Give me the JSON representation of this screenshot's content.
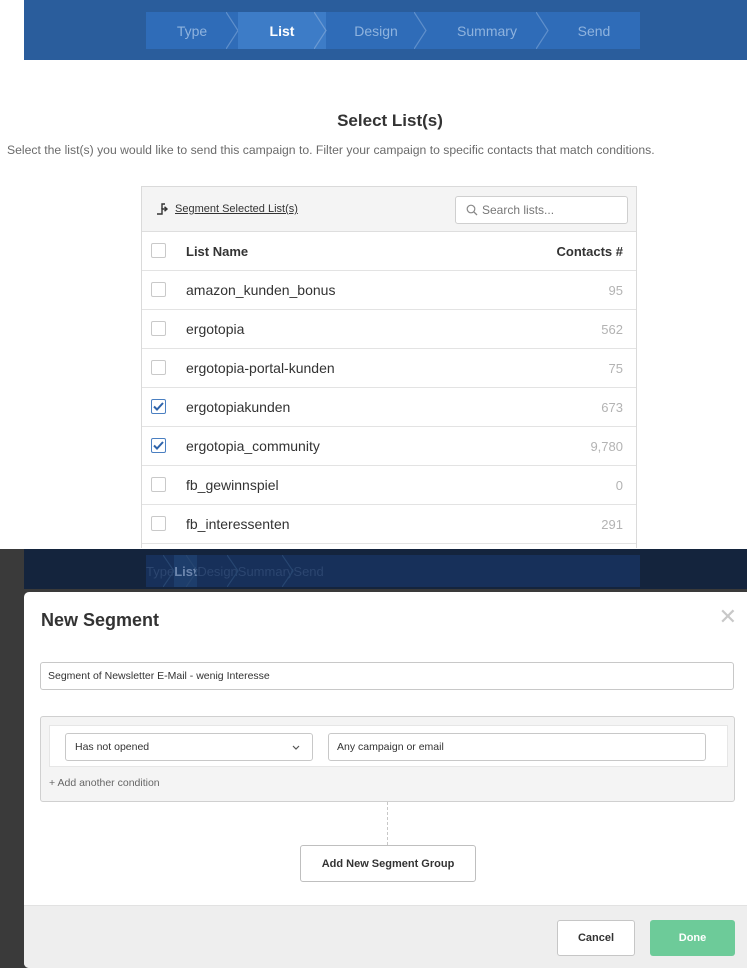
{
  "steps": [
    "Type",
    "List",
    "Design",
    "Summary",
    "Send"
  ],
  "active_step": "List",
  "page": {
    "title": "Select List(s)",
    "subtitle": "Select the list(s) you would like to send this campaign to. Filter your campaign to specific contacts that match conditions."
  },
  "panel": {
    "segment_label": "Segment Selected List(s)",
    "search_placeholder": "Search lists...",
    "header": {
      "name": "List Name",
      "count": "Contacts #"
    },
    "rows": [
      {
        "name": "amazon_kunden_bonus",
        "count": "95",
        "checked": false
      },
      {
        "name": "ergotopia",
        "count": "562",
        "checked": false
      },
      {
        "name": "ergotopia-portal-kunden",
        "count": "75",
        "checked": false
      },
      {
        "name": "ergotopiakunden",
        "count": "673",
        "checked": true
      },
      {
        "name": "ergotopia_community",
        "count": "9,780",
        "checked": true
      },
      {
        "name": "fb_gewinnspiel",
        "count": "0",
        "checked": false
      },
      {
        "name": "fb_interessenten",
        "count": "291",
        "checked": false
      }
    ]
  },
  "modal": {
    "title": "New Segment",
    "close_glyph": "✕",
    "segment_name": "Segment of Newsletter E-Mail - wenig Interesse",
    "condition": {
      "operator": "Has not opened",
      "value": "Any campaign or email"
    },
    "add_condition": "+ Add another condition",
    "add_group": "Add New Segment Group",
    "cancel": "Cancel",
    "done": "Done"
  },
  "colors": {
    "brand_blue": "#2a5d9c",
    "checkbox_blue": "#4a7fc1",
    "done_green": "#6dcb99"
  },
  "icons": {
    "segment": "segment-branch-icon",
    "search": "search-icon",
    "chevron": "chevron-down-icon",
    "close": "close-icon",
    "check": "check-icon"
  }
}
